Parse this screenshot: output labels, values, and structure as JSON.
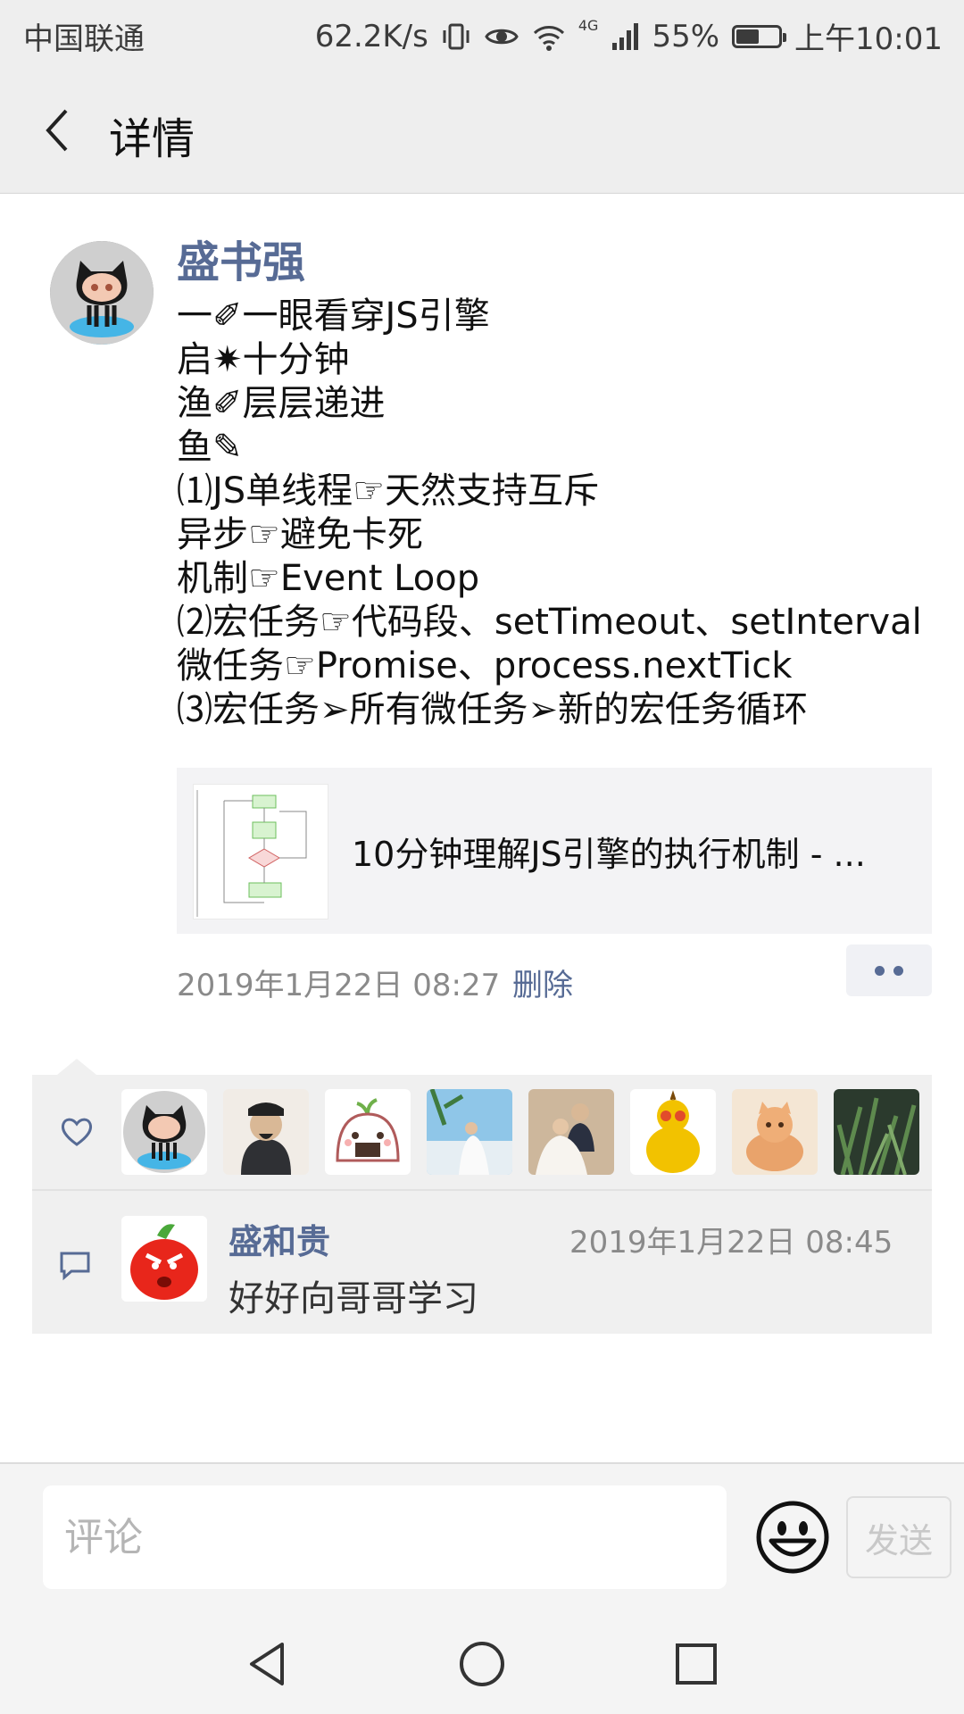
{
  "status_bar": {
    "carrier": "中国联通",
    "speed": "62.2K/s",
    "network": "4G",
    "battery_percent": "55%",
    "battery_level": 0.55,
    "time": "上午10:01"
  },
  "header": {
    "title": "详情"
  },
  "post": {
    "author": "盛书强",
    "lines": [
      "一✐一眼看穿JS引擎",
      "启✷十分钟",
      "渔✐层层递进",
      "鱼✎",
      "⑴JS单线程☞天然支持互斥",
      "异步☞避免卡死",
      "机制☞Event Loop",
      "⑵宏任务☞代码段、setTimeout、setInterval",
      "微任务☞Promise、process.nextTick",
      "⑶宏任务➢所有微任务➢新的宏任务循环"
    ],
    "link_title": "10分钟理解JS引擎的执行机制 - ...",
    "time": "2019年1月22日 08:27",
    "delete_label": "删除"
  },
  "likes": {
    "avatars": [
      "github-octocat",
      "ancient-official",
      "rice-ball-sprout",
      "wedding-beach",
      "wedding-couple",
      "yellow-gourd",
      "orange-cat",
      "green-plant"
    ]
  },
  "comments": [
    {
      "name": "盛和贵",
      "time": "2019年1月22日 08:45",
      "text": "好好向哥哥学习"
    }
  ],
  "input": {
    "placeholder": "评论",
    "send_label": "发送"
  },
  "colors": {
    "link_blue": "#576b95",
    "bar_gray": "#eeeeee"
  }
}
